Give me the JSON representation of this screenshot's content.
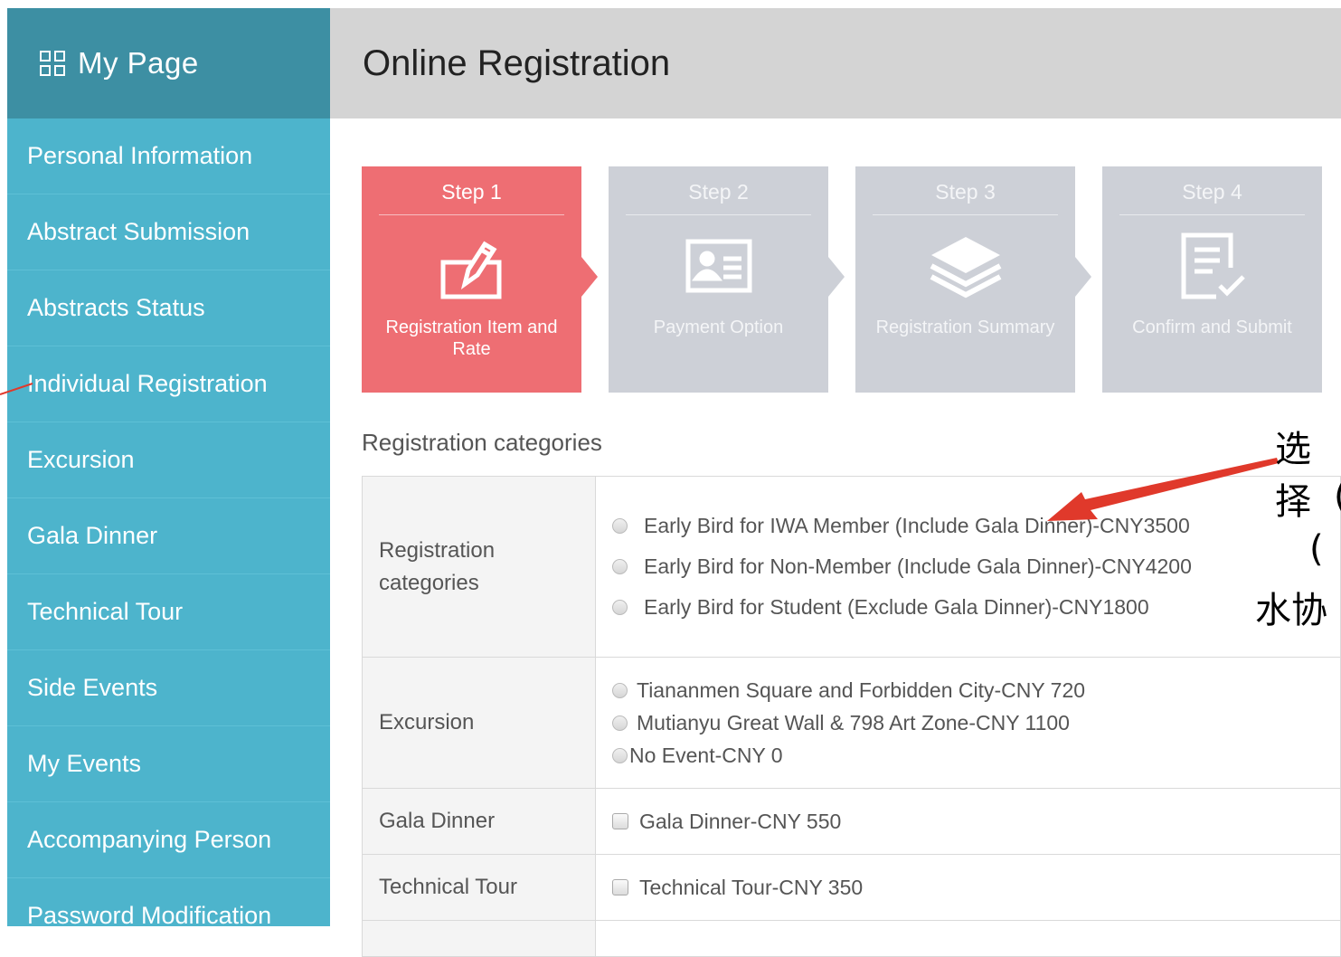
{
  "sidebar": {
    "title": "My Page",
    "items": [
      {
        "label": "Personal Information"
      },
      {
        "label": "Abstract Submission"
      },
      {
        "label": "Abstracts Status"
      },
      {
        "label": "Individual Registration"
      },
      {
        "label": "Excursion"
      },
      {
        "label": "Gala Dinner"
      },
      {
        "label": "Technical Tour"
      },
      {
        "label": "Side Events"
      },
      {
        "label": "My Events"
      },
      {
        "label": "Accompanying Person"
      },
      {
        "label": "Password Modification"
      }
    ]
  },
  "header": {
    "title": "Online Registration"
  },
  "steps": [
    {
      "label": "Step 1",
      "caption": "Registration Item and Rate",
      "icon": "edit-form-icon",
      "active": true
    },
    {
      "label": "Step 2",
      "caption": "Payment Option",
      "icon": "id-card-icon",
      "active": false
    },
    {
      "label": "Step 3",
      "caption": "Registration Summary",
      "icon": "layers-icon",
      "active": false
    },
    {
      "label": "Step 4",
      "caption": "Confirm and Submit",
      "icon": "checklist-icon",
      "active": false
    }
  ],
  "section_title": "Registration categories",
  "table": {
    "rows": [
      {
        "label": "Registration categories",
        "type": "radio",
        "options": [
          "Early Bird for IWA Member (Include Gala Dinner)-CNY3500",
          "Early Bird for Non-Member (Include Gala Dinner)-CNY4200",
          "Early Bird for Student (Exclude Gala Dinner)-CNY1800"
        ]
      },
      {
        "label": "Excursion",
        "type": "radio",
        "options": [
          "Tiananmen Square and Forbidden City-CNY 720",
          "Mutianyu Great Wall & 798 Art Zone-CNY 1100",
          "No Event-CNY 0"
        ]
      },
      {
        "label": "Gala Dinner",
        "type": "checkbox",
        "options": [
          "Gala Dinner-CNY 550"
        ]
      },
      {
        "label": "Technical Tour",
        "type": "checkbox",
        "options": [
          "Technical Tour-CNY 350"
        ]
      }
    ]
  },
  "annotation": {
    "lines": [
      "选择",
      "(",
      "(",
      "水协"
    ],
    "arrow_color": "#e0392b"
  }
}
